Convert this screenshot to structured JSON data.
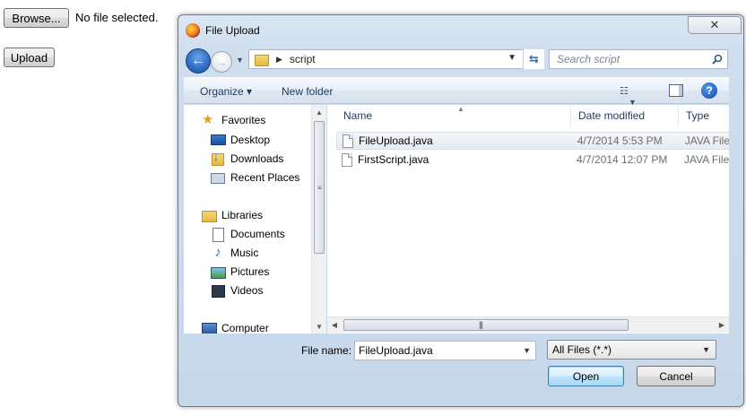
{
  "page": {
    "browse_label": "Browse...",
    "no_file_text": "No file selected.",
    "upload_label": "Upload"
  },
  "dialog": {
    "title": "File Upload",
    "close_glyph": "✕",
    "address": {
      "path": "script"
    },
    "search": {
      "placeholder": "Search script"
    },
    "toolbar": {
      "organize_label": "Organize ▾",
      "new_folder_label": "New folder",
      "help_glyph": "?"
    },
    "nav_pane": {
      "items": [
        {
          "label": "Favorites",
          "icon": "star-icon"
        },
        {
          "label": "Desktop",
          "icon": "desktop-icon"
        },
        {
          "label": "Downloads",
          "icon": "downloads-icon"
        },
        {
          "label": "Recent Places",
          "icon": "recent-places-icon"
        },
        {
          "label": "Libraries",
          "icon": "libraries-icon"
        },
        {
          "label": "Documents",
          "icon": "documents-icon"
        },
        {
          "label": "Music",
          "icon": "music-icon"
        },
        {
          "label": "Pictures",
          "icon": "pictures-icon"
        },
        {
          "label": "Videos",
          "icon": "videos-icon"
        },
        {
          "label": "Computer",
          "icon": "computer-icon"
        }
      ]
    },
    "file_list": {
      "columns": [
        "Name",
        "Date modified",
        "Type"
      ],
      "rows": [
        {
          "name": "FileUpload.java",
          "date": "4/7/2014 5:53 PM",
          "type": "JAVA File",
          "selected": true
        },
        {
          "name": "FirstScript.java",
          "date": "4/7/2014 12:07 PM",
          "type": "JAVA File",
          "selected": false
        }
      ]
    },
    "file_name": {
      "label": "File name:",
      "value": "FileUpload.java"
    },
    "file_type": {
      "selected": "All Files (*.*)"
    },
    "open_label": "Open",
    "cancel_label": "Cancel"
  }
}
